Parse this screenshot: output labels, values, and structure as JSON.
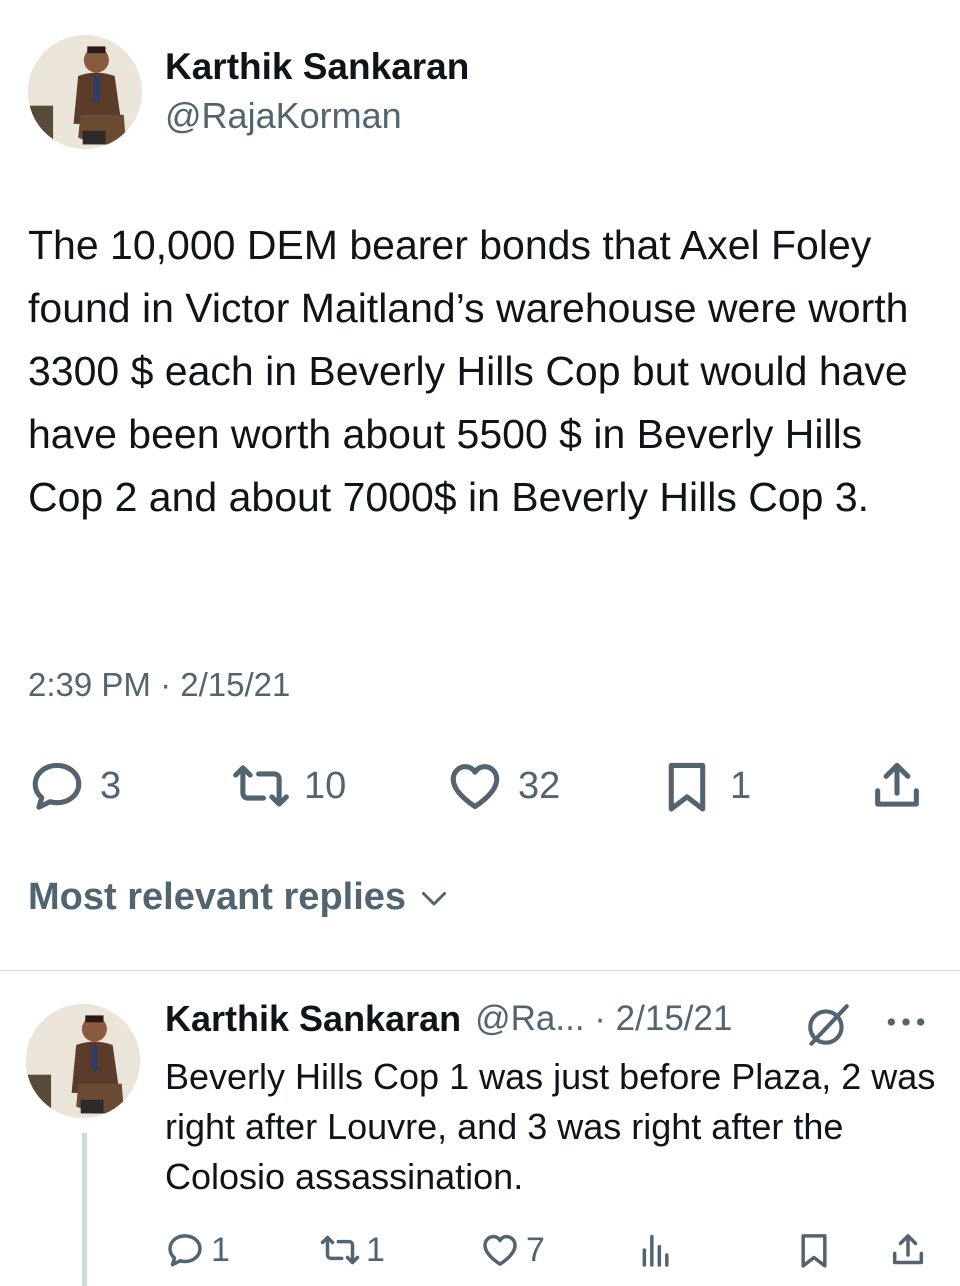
{
  "tweet": {
    "author_name": "Karthik Sankaran",
    "author_handle": "@RajaKorman",
    "text": "The 10,000 DEM bearer bonds that Axel Foley found in Victor Maitland’s warehouse were worth 3300 $ each in Beverly Hills Cop but would have have been worth about 5500 $ in Beverly Hills Cop 2 and about 7000$ in Beverly Hills Cop 3.",
    "timestamp": "2:39 PM · 2/15/21",
    "actions": {
      "replies": "3",
      "retweets": "10",
      "likes": "32",
      "bookmarks": "1"
    }
  },
  "replies_sort": {
    "label": "Most relevant replies"
  },
  "reply": {
    "author_name": "Karthik Sankaran",
    "author_handle_date": "@Ra... · 2/15/21",
    "text": "Beverly Hills Cop 1 was just before Plaza, 2 was right after Louvre, and 3 was right after the Colosio assassination.",
    "actions": {
      "replies": "1",
      "retweets": "1",
      "likes": "7"
    }
  },
  "icons": {
    "reply": "speech-bubble-icon",
    "retweet": "retweet-icon",
    "like": "heart-icon",
    "bookmark": "bookmark-icon",
    "share": "share-icon",
    "views": "bar-chart-icon",
    "grok": "grok-icon",
    "more": "more-dots-icon",
    "sort": "chevron-down-icon"
  },
  "colors": {
    "text": "#0f1419",
    "secondary": "#536471",
    "divider": "#cfd9de"
  }
}
